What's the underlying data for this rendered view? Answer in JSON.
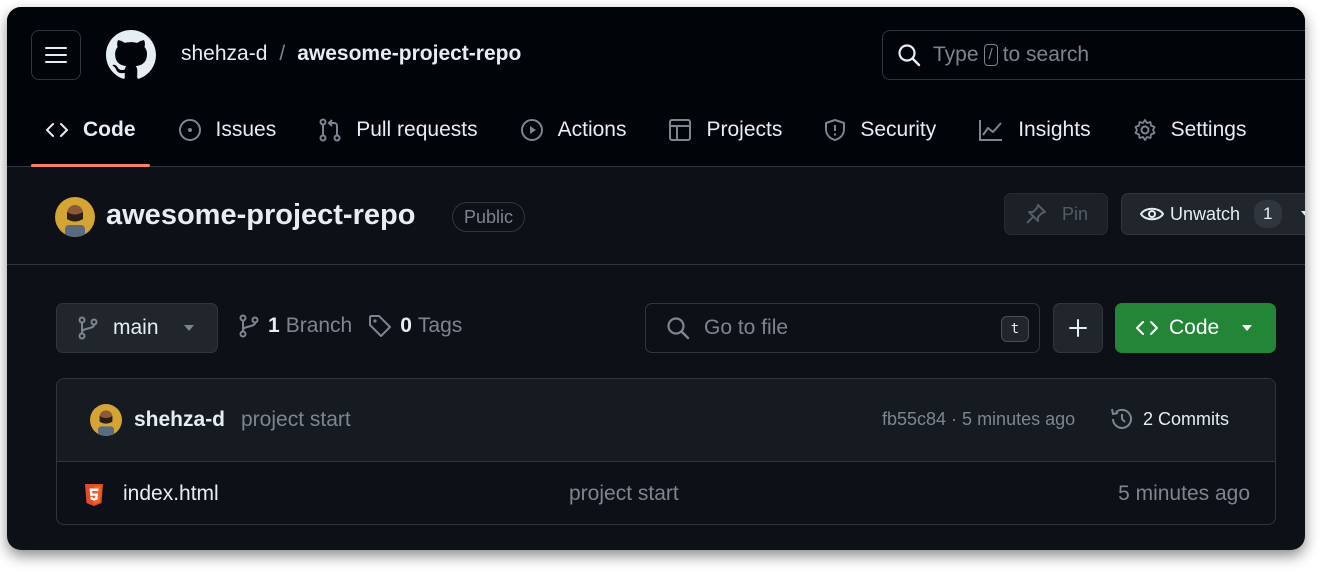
{
  "header": {
    "owner": "shehza-d",
    "separator": "/",
    "repo": "awesome-project-repo",
    "search_prefix": "Type",
    "search_key": "/",
    "search_suffix": "to search"
  },
  "tabs": [
    {
      "label": "Code",
      "icon": "code-icon",
      "active": true
    },
    {
      "label": "Issues",
      "icon": "issue-icon"
    },
    {
      "label": "Pull requests",
      "icon": "pull-request-icon"
    },
    {
      "label": "Actions",
      "icon": "play-icon"
    },
    {
      "label": "Projects",
      "icon": "table-icon"
    },
    {
      "label": "Security",
      "icon": "shield-icon"
    },
    {
      "label": "Insights",
      "icon": "graph-icon"
    },
    {
      "label": "Settings",
      "icon": "gear-icon"
    }
  ],
  "repo": {
    "title": "awesome-project-repo",
    "visibility": "Public",
    "pin_label": "Pin",
    "watch_label": "Unwatch",
    "watch_count": "1"
  },
  "toolbar": {
    "branch": "main",
    "branch_count": "1",
    "branch_label": "Branch",
    "tag_count": "0",
    "tag_label": "Tags",
    "goto_placeholder": "Go to file",
    "goto_key": "t",
    "code_label": "Code"
  },
  "commit": {
    "author": "shehza-d",
    "message": "project start",
    "meta": "fb55c84 · 5 minutes ago",
    "commits_label": "2 Commits"
  },
  "files": [
    {
      "name": "index.html",
      "message": "project start",
      "time": "5 minutes ago",
      "icon": "html5-icon"
    }
  ],
  "colors": {
    "bg": "#0d1117",
    "header_bg": "#010409",
    "accent_underline": "#f78166",
    "code_button": "#238636",
    "html_icon": "#e34c26"
  }
}
